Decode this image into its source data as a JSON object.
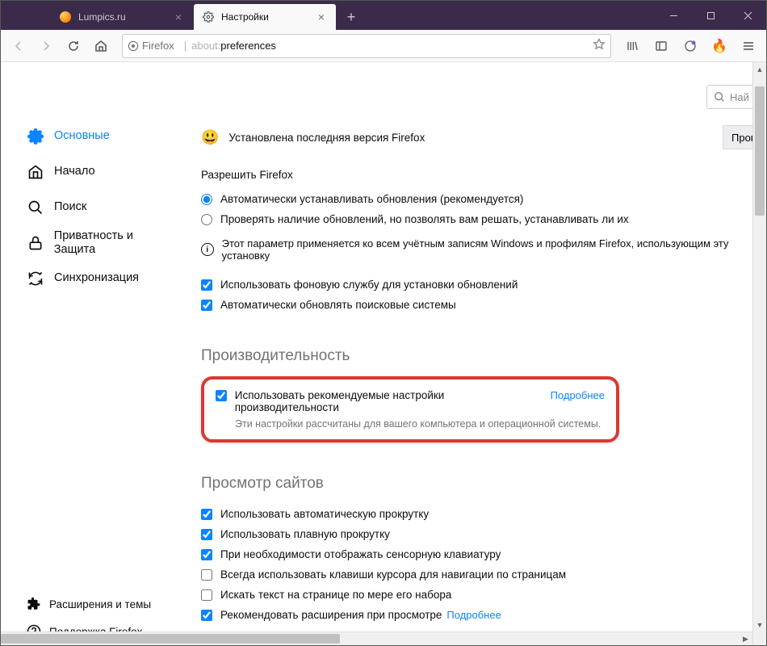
{
  "window": {
    "tabs": [
      {
        "label": "Lumpics.ru",
        "active": false
      },
      {
        "label": "Настройки",
        "active": true
      }
    ]
  },
  "urlbar": {
    "identity": "Firefox",
    "address_prefix": "about:",
    "address_page": "preferences"
  },
  "sidebar": {
    "items": [
      {
        "label": "Основные"
      },
      {
        "label": "Начало"
      },
      {
        "label": "Поиск"
      },
      {
        "label": "Приватность и Защита"
      },
      {
        "label": "Синхронизация"
      }
    ],
    "footer": [
      {
        "label": "Расширения и темы"
      },
      {
        "label": "Поддержка Firefox"
      }
    ]
  },
  "search_pref_placeholder": "Най",
  "updates": {
    "status": "Установлена последняя версия Firefox",
    "check_button": "Провер",
    "allow_label": "Разрешить Firefox",
    "radio_auto": "Автоматически устанавливать обновления (рекомендуется)",
    "radio_manual": "Проверять наличие обновлений, но позволять вам решать, устанавливать ли их",
    "info": "Этот параметр применяется ко всем учётным записям Windows и профилям Firefox, использующим эту установку",
    "chk_bg": "Использовать фоновую службу для установки обновлений",
    "chk_engines": "Автоматически обновлять поисковые системы"
  },
  "performance": {
    "title": "Производительность",
    "chk_recommended": "Использовать рекомендуемые настройки производительности",
    "learn_more": "Подробнее",
    "desc": "Эти настройки рассчитаны для вашего компьютера и операционной системы."
  },
  "browsing": {
    "title": "Просмотр сайтов",
    "chk_autoscroll": "Использовать автоматическую прокрутку",
    "chk_smooth": "Использовать плавную прокрутку",
    "chk_touchkb": "При необходимости отображать сенсорную клавиатуру",
    "chk_caret": "Всегда использовать клавиши курсора для навигации по страницам",
    "chk_searchtype": "Искать текст на странице по мере его набора",
    "chk_recommend_ext": "Рекомендовать расширения при просмотре",
    "learn_more": "Подробнее"
  }
}
